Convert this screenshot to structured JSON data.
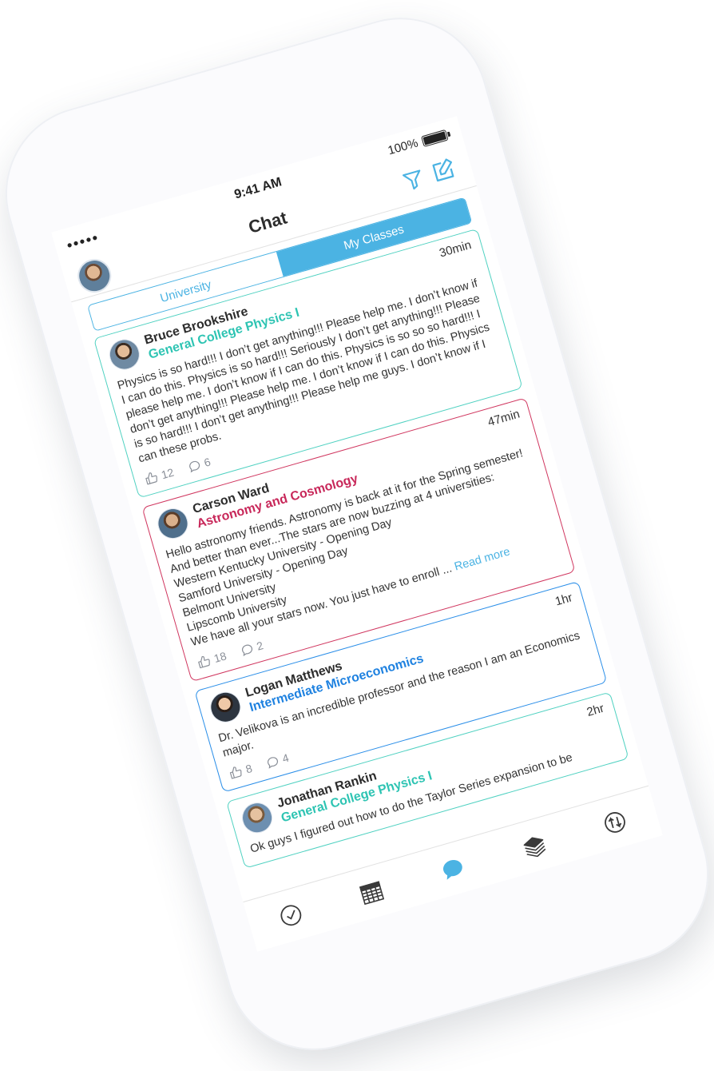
{
  "status_bar": {
    "signal": "●●●●●",
    "time": "9:41 AM",
    "battery": "100%"
  },
  "nav": {
    "title": "Chat"
  },
  "segment": {
    "left_label": "University",
    "right_label": "My Classes",
    "selected": "My Classes"
  },
  "posts": [
    {
      "author": "Bruce Brookshire",
      "course": "General College Physics I",
      "time": "30min",
      "body": "Physics is so hard!!! I don’t get anything!!! Please help me. I don’t know if I can do this. Physics is so hard!!! Seriously I don’t get anything!!! Please please help me. I don’t know if I can do this. Physics is so so so hard!!! I don’t get anything!!! Please help me. I don’t know if I can do this. Physics is so hard!!! I don’t get anything!!! Please help me guys. I don’t know if I can these probs.",
      "likes": "12",
      "comments": "6"
    },
    {
      "author": "Carson Ward",
      "course": "Astronomy and Cosmology",
      "time": "47min",
      "body": "Hello astronomy friends. Astronomy is back at it for the Spring semester! And better than ever...The stars are now buzzing at 4 universities:\nWestern Kentucky University - Opening Day\nSamford University - Opening Day\nBelmont University\nLipscomb University\nWe have all your stars now. You just have to enroll ... ",
      "read_more": "Read more",
      "likes": "18",
      "comments": "2"
    },
    {
      "author": "Logan Matthews",
      "course": "Intermediate Microeconomics",
      "time": "1hr",
      "body": "Dr. Velikova is an incredible professor and the reason I am an Economics major.",
      "likes": "8",
      "comments": "4"
    },
    {
      "author": "Jonathan Rankin",
      "course": "General College Physics I",
      "time": "2hr",
      "body": "Ok guys I figured out how to do the Taylor Series expansion to be"
    }
  ],
  "tab_bar": {
    "items": [
      "check-icon",
      "calendar-icon",
      "chat-icon",
      "books-icon",
      "sort-icon"
    ]
  },
  "colors": {
    "accent": "#4bb3e3",
    "teal": "#2ec4b3",
    "magenta": "#c8285a",
    "blue": "#1f82e0"
  }
}
